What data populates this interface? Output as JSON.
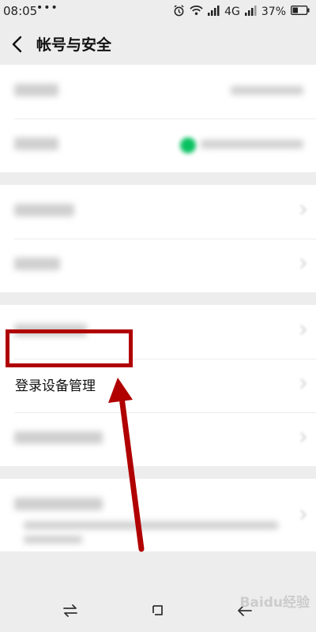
{
  "status_bar": {
    "time": "08:05",
    "dots": "•••",
    "network": "4G",
    "battery": "37%"
  },
  "header": {
    "title": "帐号与安全"
  },
  "list": {
    "highlighted_item": "登录设备管理"
  },
  "watermark": "Baidu经验",
  "colors": {
    "background": "#ededed",
    "highlight": "#b00000",
    "toggle_on": "#07c160"
  },
  "icons": {
    "back": "chevron-left-icon",
    "alarm": "alarm-icon",
    "wifi": "wifi-icon",
    "signal": "signal-icon",
    "battery": "battery-icon",
    "nav_switch": "switch-apps-icon",
    "nav_home": "home-square-icon",
    "nav_back": "back-arrow-icon"
  }
}
